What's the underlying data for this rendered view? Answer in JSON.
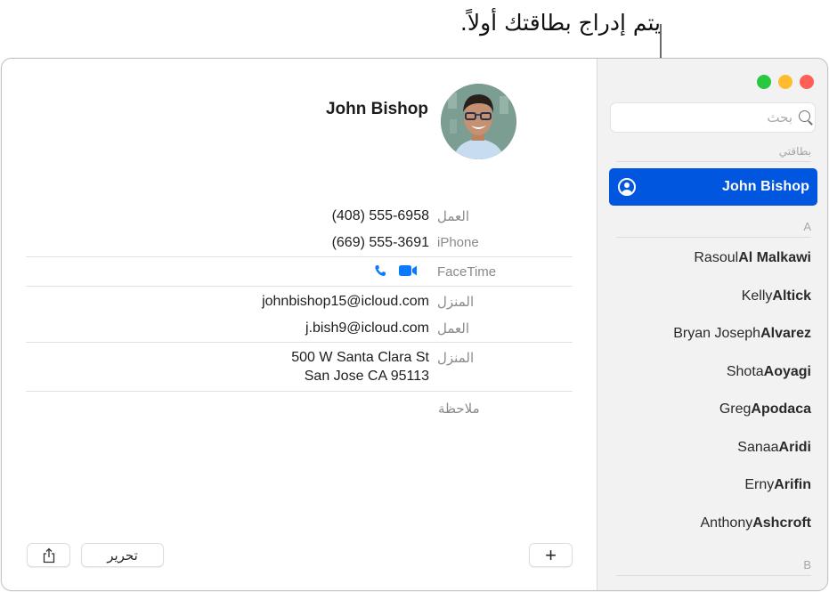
{
  "callout": {
    "text": "يتم إدراج بطاقتك أولاً."
  },
  "window": {
    "traffic_lights": [
      "close",
      "minimize",
      "zoom"
    ]
  },
  "sidebar": {
    "search_placeholder": "بحث",
    "my_card_header": "بطاقتي",
    "my_card": {
      "name": "John Bishop",
      "icon": "person-circle-icon"
    },
    "sections": [
      {
        "letter": "A",
        "contacts": [
          {
            "first": "Rasoul",
            "last": "Al Malkawi"
          },
          {
            "first": "Kelly",
            "last": "Altick"
          },
          {
            "first": "Bryan Joseph",
            "last": "Alvarez"
          },
          {
            "first": "Shota",
            "last": "Aoyagi"
          },
          {
            "first": "Greg",
            "last": "Apodaca"
          },
          {
            "first": "Sanaa",
            "last": "Aridi"
          },
          {
            "first": "Erny",
            "last": "Arifin"
          },
          {
            "first": "Anthony",
            "last": "Ashcroft"
          }
        ]
      },
      {
        "letter": "B",
        "contacts": []
      }
    ]
  },
  "detail": {
    "name": "John Bishop",
    "phones": [
      {
        "label": "العمل",
        "value": "(408) 555-6958"
      },
      {
        "label": "iPhone",
        "value": "(669) 555-3691"
      }
    ],
    "facetime": {
      "label": "FaceTime",
      "icons": [
        "phone-icon",
        "video-camera-icon"
      ]
    },
    "emails": [
      {
        "label": "المنزل",
        "value": "johnbishop15@icloud.com"
      },
      {
        "label": "العمل",
        "value": "j.bish9@icloud.com"
      }
    ],
    "address": {
      "label": "المنزل",
      "line1": "500 W Santa Clara St",
      "line2": "San Jose CA 95113"
    },
    "note_label": "ملاحظة"
  },
  "toolbar": {
    "edit_label": "تحرير",
    "add_label": "+",
    "share_icon": "share-icon"
  },
  "colors": {
    "accent": "#0156e0",
    "facetime_blue": "#0a7aff",
    "close": "#fe5f57",
    "minimize": "#febc2e",
    "zoom": "#28c840"
  }
}
